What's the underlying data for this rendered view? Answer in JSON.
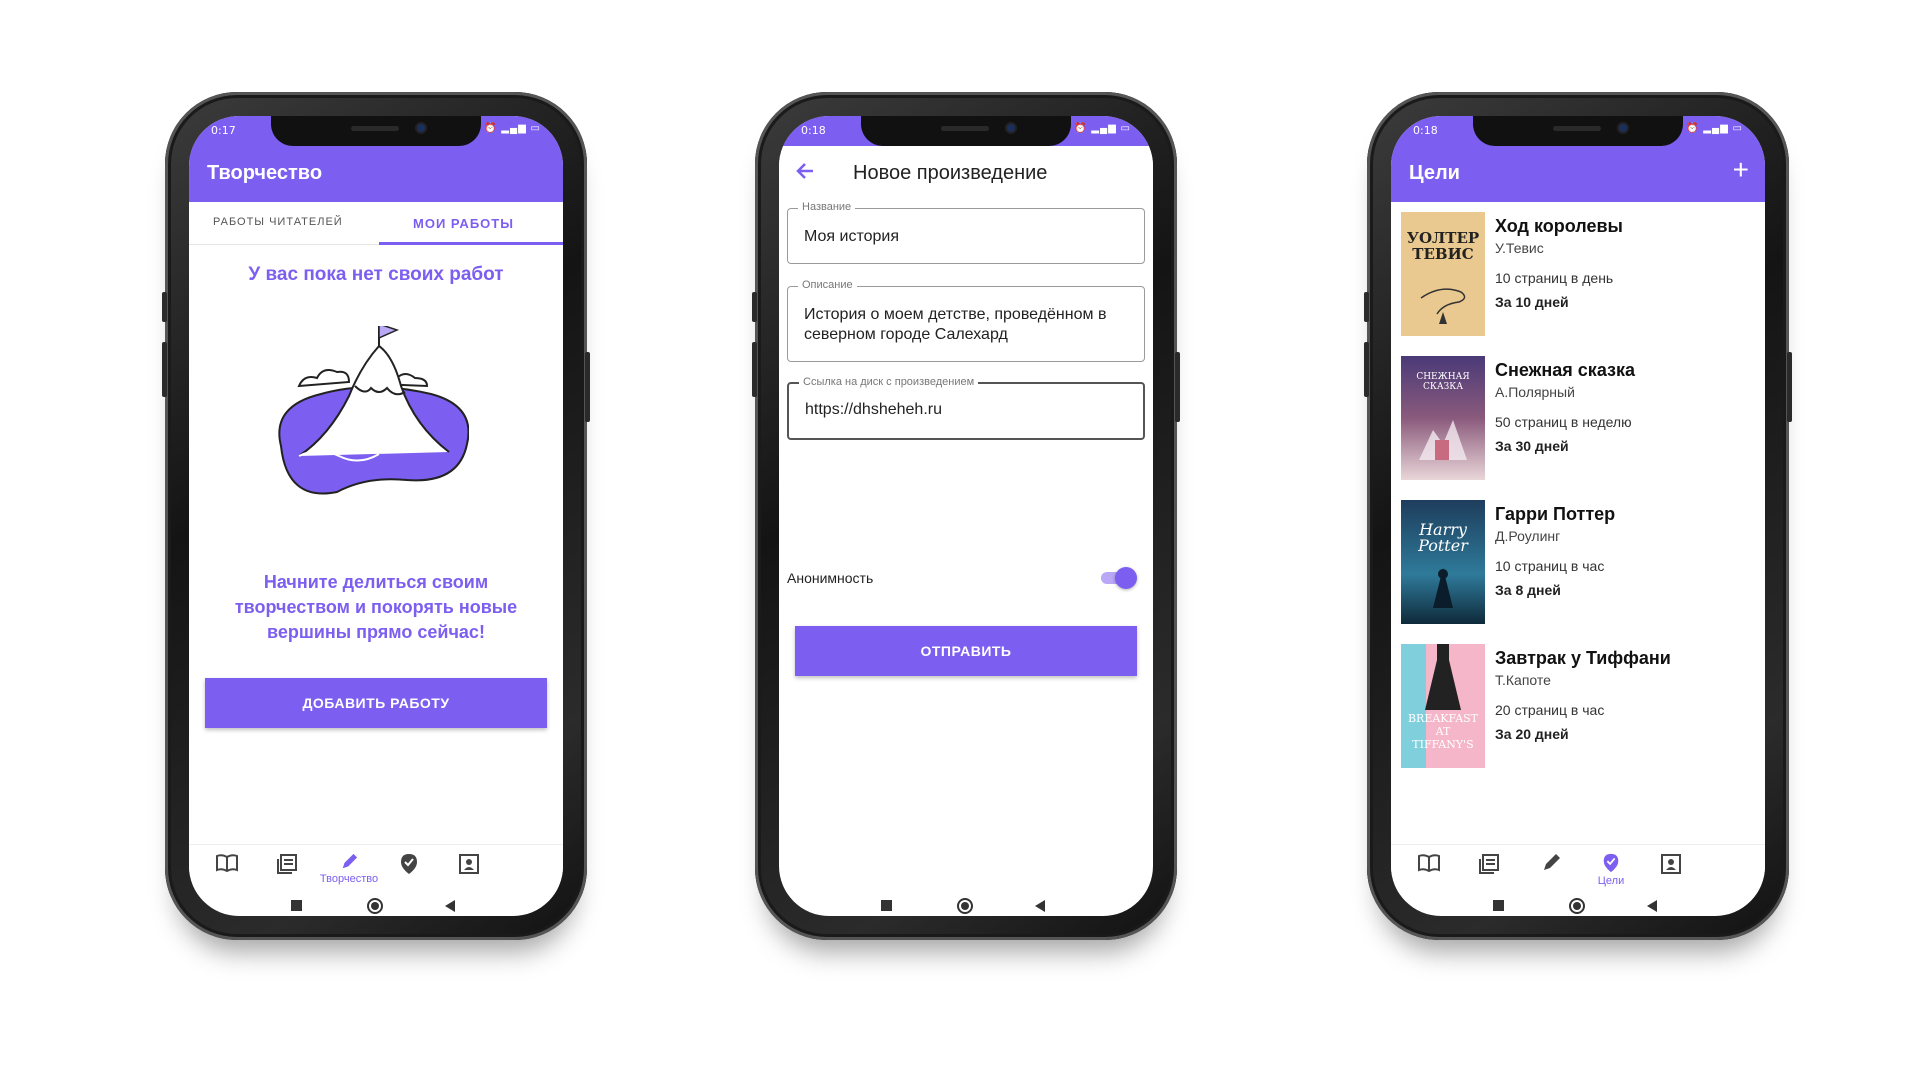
{
  "statusbar": {
    "time_left": "0:17",
    "time_mid": "0:18",
    "time_right": "0:18",
    "icons": "⏰  ▂▄▆ ▭"
  },
  "phone1": {
    "app_title": "Творчество",
    "tabs": [
      "РАБОТЫ ЧИТАТЕЛЕЙ",
      "МОИ РАБОТЫ"
    ],
    "empty_title": "У вас пока нет своих работ",
    "cta_text": "Начните делиться своим творчеством и покорять новые вершины прямо сейчас!",
    "add_button": "ДОБАВИТЬ РАБОТУ",
    "active_nav_label": "Творчество"
  },
  "phone2": {
    "app_title": "Новое произведение",
    "fields": [
      {
        "legend": "Название",
        "value": "Моя история"
      },
      {
        "legend": "Описание",
        "value": "История о моем детстве, проведённом в северном городе Салехард"
      },
      {
        "legend": "Ссылка на диск с произведением",
        "value": "https://dhsheheh.ru"
      }
    ],
    "anonymity_label": "Анонимность",
    "anonymity_on": true,
    "submit_button": "ОТПРАВИТЬ"
  },
  "phone3": {
    "app_title": "Цели",
    "add_icon": "+",
    "active_nav_label": "Цели",
    "books": [
      {
        "title": "Ход королевы",
        "author": "У.Тевис",
        "pace": "10 страниц в день",
        "days": "За 10 дней",
        "cover_text": "УОЛТЕР ТЕВИС",
        "cover_color": "#e9c98f"
      },
      {
        "title": "Снежная сказка",
        "author": "А.Полярный",
        "pace": "50 страниц в неделю",
        "days": "За 30 дней",
        "cover_text": "СНЕЖНАЯ СКАЗКА",
        "cover_color": "#6b4a8c"
      },
      {
        "title": "Гарри Поттер",
        "author": "Д.Роулинг",
        "pace": "10 страниц в час",
        "days": "За 8 дней",
        "cover_text": "Harry Potter",
        "cover_color": "#1f5a7a"
      },
      {
        "title": "Завтрак у Тиффани",
        "author": "Т.Капоте",
        "pace": "20 страниц в час",
        "days": "За 20 дней",
        "cover_text": "BREAKFAST AT TIFFANY'S",
        "cover_color": "#f2b8c8"
      }
    ]
  },
  "colors": {
    "accent": "#7c5ef0",
    "accent_light": "#b9a8f6"
  }
}
